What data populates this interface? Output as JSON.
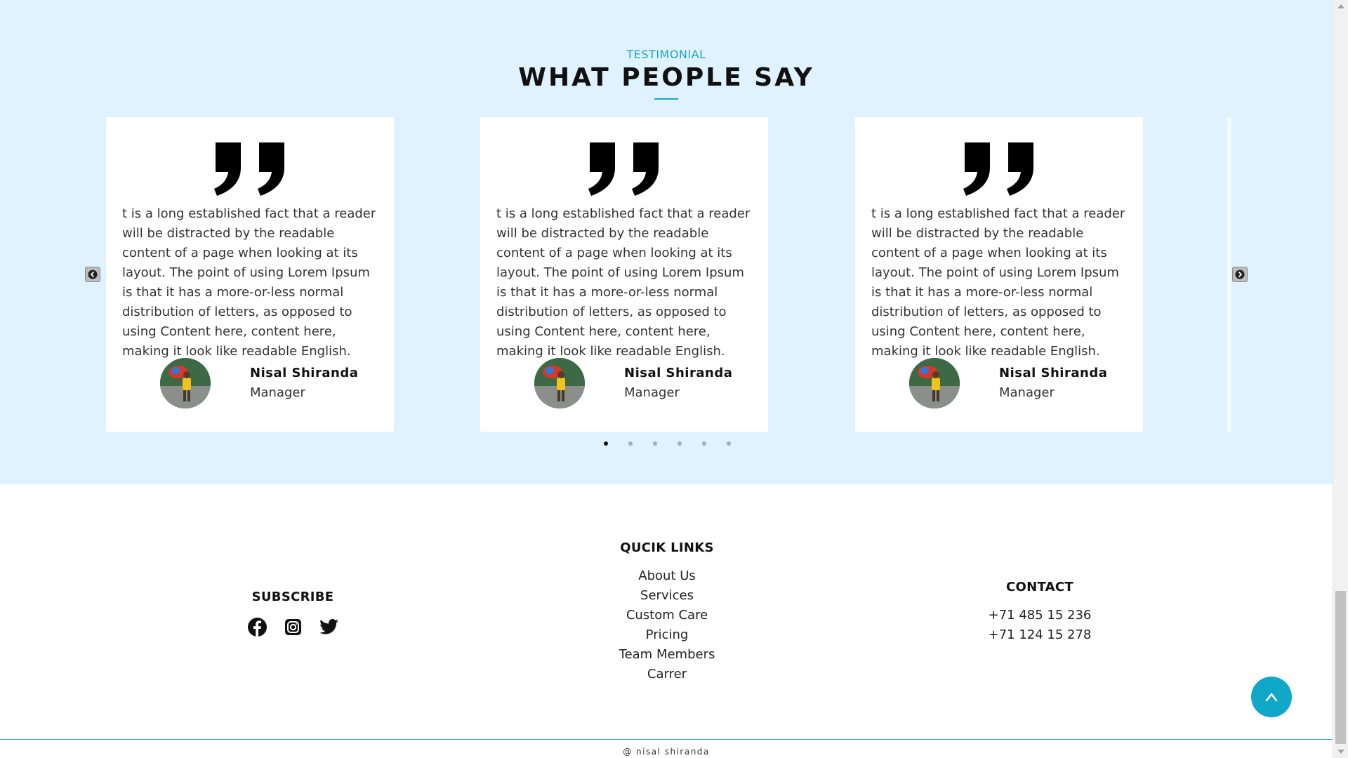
{
  "testimonial": {
    "eyebrow": "TESTIMONIAL",
    "title": "WHAT PEOPLE SAY",
    "cards": [
      {
        "text": "t is a long established fact that a reader will be distracted by the readable content of a page when looking at its layout. The point of using Lorem Ipsum is that it has a more-or-less normal distribution of letters, as opposed to using Content here, content here, making it look like readable English.",
        "name": "Nisal Shiranda",
        "role": "Manager"
      },
      {
        "text": "t is a long established fact that a reader will be distracted by the readable content of a page when looking at its layout. The point of using Lorem Ipsum is that it has a more-or-less normal distribution of letters, as opposed to using Content here, content here, making it look like readable English.",
        "name": "Nisal Shiranda",
        "role": "Manager"
      },
      {
        "text": "t is a long established fact that a reader will be distracted by the readable content of a page when looking at its layout. The point of using Lorem Ipsum is that it has a more-or-less normal distribution of letters, as opposed to using Content here, content here, making it look like readable English.",
        "name": "Nisal Shiranda",
        "role": "Manager"
      }
    ],
    "carousel": {
      "dot_count": 6,
      "active_index": 0
    },
    "icons": {
      "prev": "chevron-left-icon",
      "next": "chevron-right-icon",
      "quote": "quote-icon"
    }
  },
  "footer": {
    "subscribe": {
      "heading": "SUBSCRIBE",
      "social_icons": [
        "facebook-icon",
        "instagram-icon",
        "twitter-icon"
      ]
    },
    "quick_links": {
      "heading": "QUCIK LINKS",
      "items": [
        "About Us",
        "Services",
        "Custom Care",
        "Pricing",
        "Team Members",
        "Carrer"
      ]
    },
    "contact": {
      "heading": "CONTACT",
      "phones": [
        "+71 485 15 236",
        "+71 124 15 278"
      ]
    },
    "back_to_top_glyph": "^",
    "copyright": "@ nisal shiranda"
  },
  "colors": {
    "section_bg": "#dff2fd",
    "accent": "#1aa6c4",
    "back_to_top": "#11a7c9"
  }
}
